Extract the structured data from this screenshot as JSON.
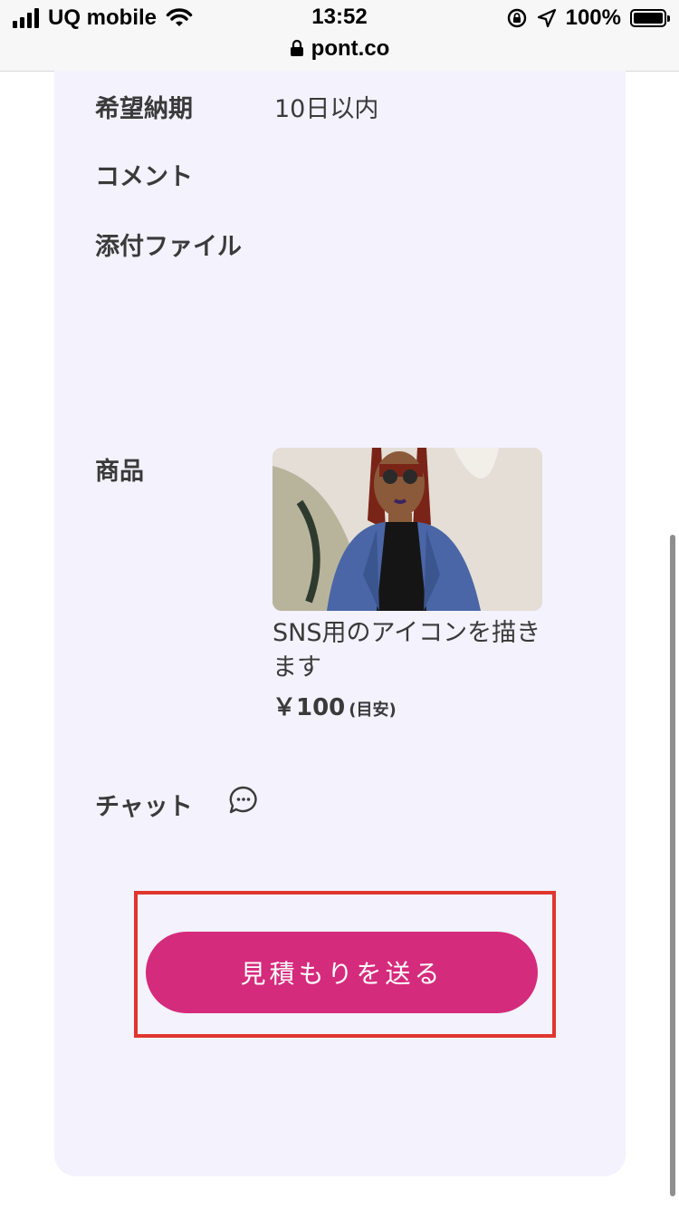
{
  "status_bar": {
    "carrier": "UQ mobile",
    "time": "13:52",
    "battery": "100%",
    "url": "pont.co"
  },
  "details": {
    "delivery_label": "希望納期",
    "delivery_value": "10日以内",
    "comment_label": "コメント",
    "attachment_label": "添付ファイル",
    "product_label": "商品",
    "product_title": "SNS用のアイコンを描きます",
    "product_price": "￥100",
    "product_price_note": "(目安)",
    "chat_label": "チャット"
  },
  "actions": {
    "send_estimate": "見積もりを送る"
  },
  "colors": {
    "card_bg": "#f3f2fd",
    "button": "#d52b7c",
    "highlight": "#e0362e"
  },
  "icons": [
    "signal-icon",
    "wifi-icon",
    "lock-icon",
    "orientation-lock-icon",
    "location-icon",
    "battery-icon",
    "chat-bubble-icon"
  ]
}
